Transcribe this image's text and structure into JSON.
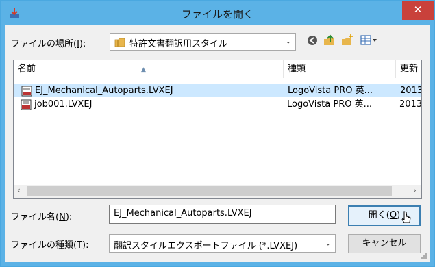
{
  "window": {
    "title": "ファイルを開く",
    "close_glyph": "✕"
  },
  "location": {
    "label_prefix": "ファイルの場所(",
    "label_key": "I",
    "label_suffix": "):",
    "value": "特許文書翻訳用スタイル"
  },
  "toolbar": {
    "icons": [
      "back-icon",
      "up-folder-icon",
      "new-folder-icon",
      "view-menu-icon"
    ]
  },
  "list": {
    "columns": [
      "名前",
      "種類",
      "更新"
    ],
    "rows": [
      {
        "name": "EJ_Mechanical_Autoparts.LVXEJ",
        "type": "LogoVista PRO 英...",
        "date": "2013"
      },
      {
        "name": "job001.LVXEJ",
        "type": "LogoVista PRO 英...",
        "date": "2013"
      }
    ],
    "selected_index": 0
  },
  "filename": {
    "label_prefix": "ファイル名(",
    "label_key": "N",
    "label_suffix": "):",
    "value": "EJ_Mechanical_Autoparts.LVXEJ"
  },
  "filetype": {
    "label_prefix": "ファイルの種類(",
    "label_key": "T",
    "label_suffix": "):",
    "value": "翻訳スタイルエクスポートファイル (*.LVXEJ)"
  },
  "buttons": {
    "open_prefix": "開く(",
    "open_key": "O",
    "open_suffix": ")",
    "cancel": "キャンセル"
  },
  "colors": {
    "titlebar": "#5bb2e6",
    "close": "#c9413b",
    "selection": "#cce8ff"
  }
}
